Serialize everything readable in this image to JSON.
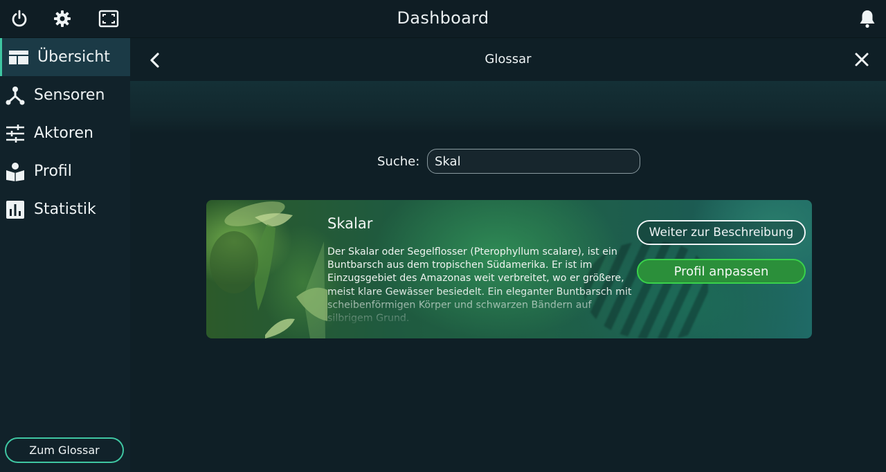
{
  "topbar": {
    "title": "Dashboard",
    "icons": [
      "power-icon",
      "gear-icon",
      "fullscreen-icon",
      "bell-icon"
    ]
  },
  "sidebar": {
    "items": [
      {
        "label": "Übersicht",
        "icon": "layout-icon",
        "active": true
      },
      {
        "label": "Sensoren",
        "icon": "sensor-network-icon",
        "active": false
      },
      {
        "label": "Aktoren",
        "icon": "sliders-icon",
        "active": false
      },
      {
        "label": "Profil",
        "icon": "reader-icon",
        "active": false
      },
      {
        "label": "Statistik",
        "icon": "bar-chart-icon",
        "active": false
      }
    ],
    "glossar_button": "Zum Glossar"
  },
  "panel": {
    "title": "Glossar"
  },
  "search": {
    "label": "Suche:",
    "value": "Skal"
  },
  "result": {
    "title": "Skalar",
    "description": "Der Skalar oder Segelflosser (Pterophyllum scalare), ist ein Buntbarsch aus dem tropischen Südamerika. Er ist im Einzugsgebiet des Amazonas weit verbreitet, wo er größere, meist klare Gewässer besiedelt. Ein eleganter Buntbarsch mit scheibenförmigen Körper und schwarzen Bändern auf silbrigem Grund.",
    "description_button": "Weiter zur Beschreibung",
    "profile_button": "Profil anpassen"
  },
  "colors": {
    "accent": "#3fc6a2",
    "green_button": "#2b8f3a",
    "green_border": "#39d24a",
    "background": "#0f1f26"
  }
}
